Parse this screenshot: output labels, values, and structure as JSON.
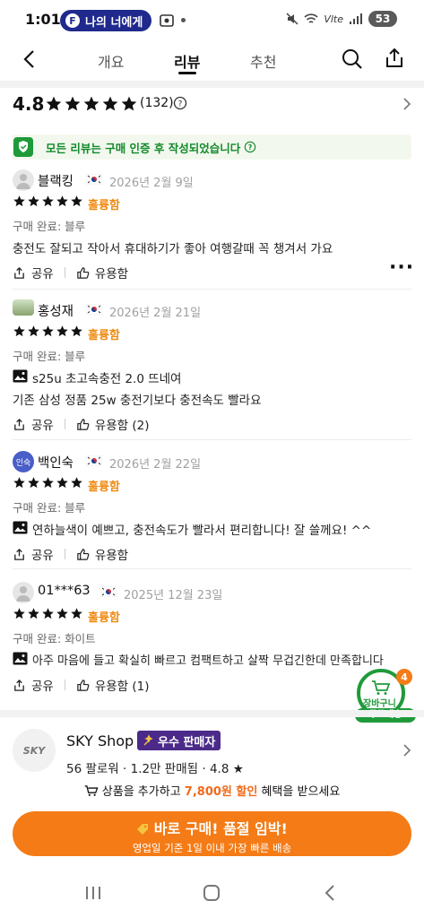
{
  "status_bar": {
    "time": "1:01",
    "pill_text": "나의 너에게",
    "battery": "53"
  },
  "nav": {
    "tabs": [
      "개요",
      "리뷰",
      "추천"
    ],
    "active": "리뷰"
  },
  "summary": {
    "score": "4.8",
    "count": "(132)"
  },
  "verify_notice": "모든 리뷰는 구매 인증 후 작성되었습니다",
  "reviews": [
    {
      "name": "블랙킹",
      "date": "2026년 2월 9일",
      "rating_label": "훌륭함",
      "option": "구매 완료: 블루",
      "lines": [
        "충전도 잘되고 작아서 휴대하기가 좋아 여행갈때 꼭 챙겨서 가요"
      ],
      "share": "공유",
      "helpful": "유용함"
    },
    {
      "name": "홍성재",
      "date": "2026년 2월 21일",
      "rating_label": "훌륭함",
      "option": "구매 완료: 블루",
      "lines": [
        "s25u 초고속충전 2.0 뜨네여",
        "기존 삼성 정품 25w 충전기보다 충전속도 빨라요"
      ],
      "share": "공유",
      "helpful": "유용함 (2)"
    },
    {
      "name": "백인숙",
      "avatar_text": "인숙",
      "date": "2026년 2월 22일",
      "rating_label": "훌륭함",
      "option": "구매 완료: 블루",
      "lines": [
        "연하늘색이 예쁘고, 충전속도가 빨라서 편리합니다! 잘 쓸께요! ^^"
      ],
      "share": "공유",
      "helpful": "유용함"
    },
    {
      "name": "01***63",
      "date": "2025년 12월 23일",
      "rating_label": "훌륭함",
      "option": "구매 완료: 화이트",
      "lines": [
        "아주 마음에 들고 확실히 빠르고 컴팩트하고 살짝 무겁긴한데 만족합니다"
      ],
      "share": "공유",
      "helpful": "유용함 (1)"
    }
  ],
  "cart": {
    "label": "장바구니",
    "count": "4",
    "shipping": "무료배송"
  },
  "shop": {
    "logo": "SKY",
    "name": "SKY Shop",
    "badge": "우수 판매자",
    "followers": "56 팔로워",
    "sold": "1.2만 판매됨",
    "rating": "4.8"
  },
  "promo": {
    "prefix": "상품을 추가하고",
    "amount": "7,800원 할인",
    "suffix": "혜택을 받으세요"
  },
  "buy_button": {
    "title": "바로 구매! 품절 임박!",
    "subtitle": "영업일 기준 1일 이내 가장 빠른 배송"
  },
  "colors": {
    "orange": "#f47b16",
    "green": "#128a2b",
    "badge": "#4b2a8a"
  }
}
